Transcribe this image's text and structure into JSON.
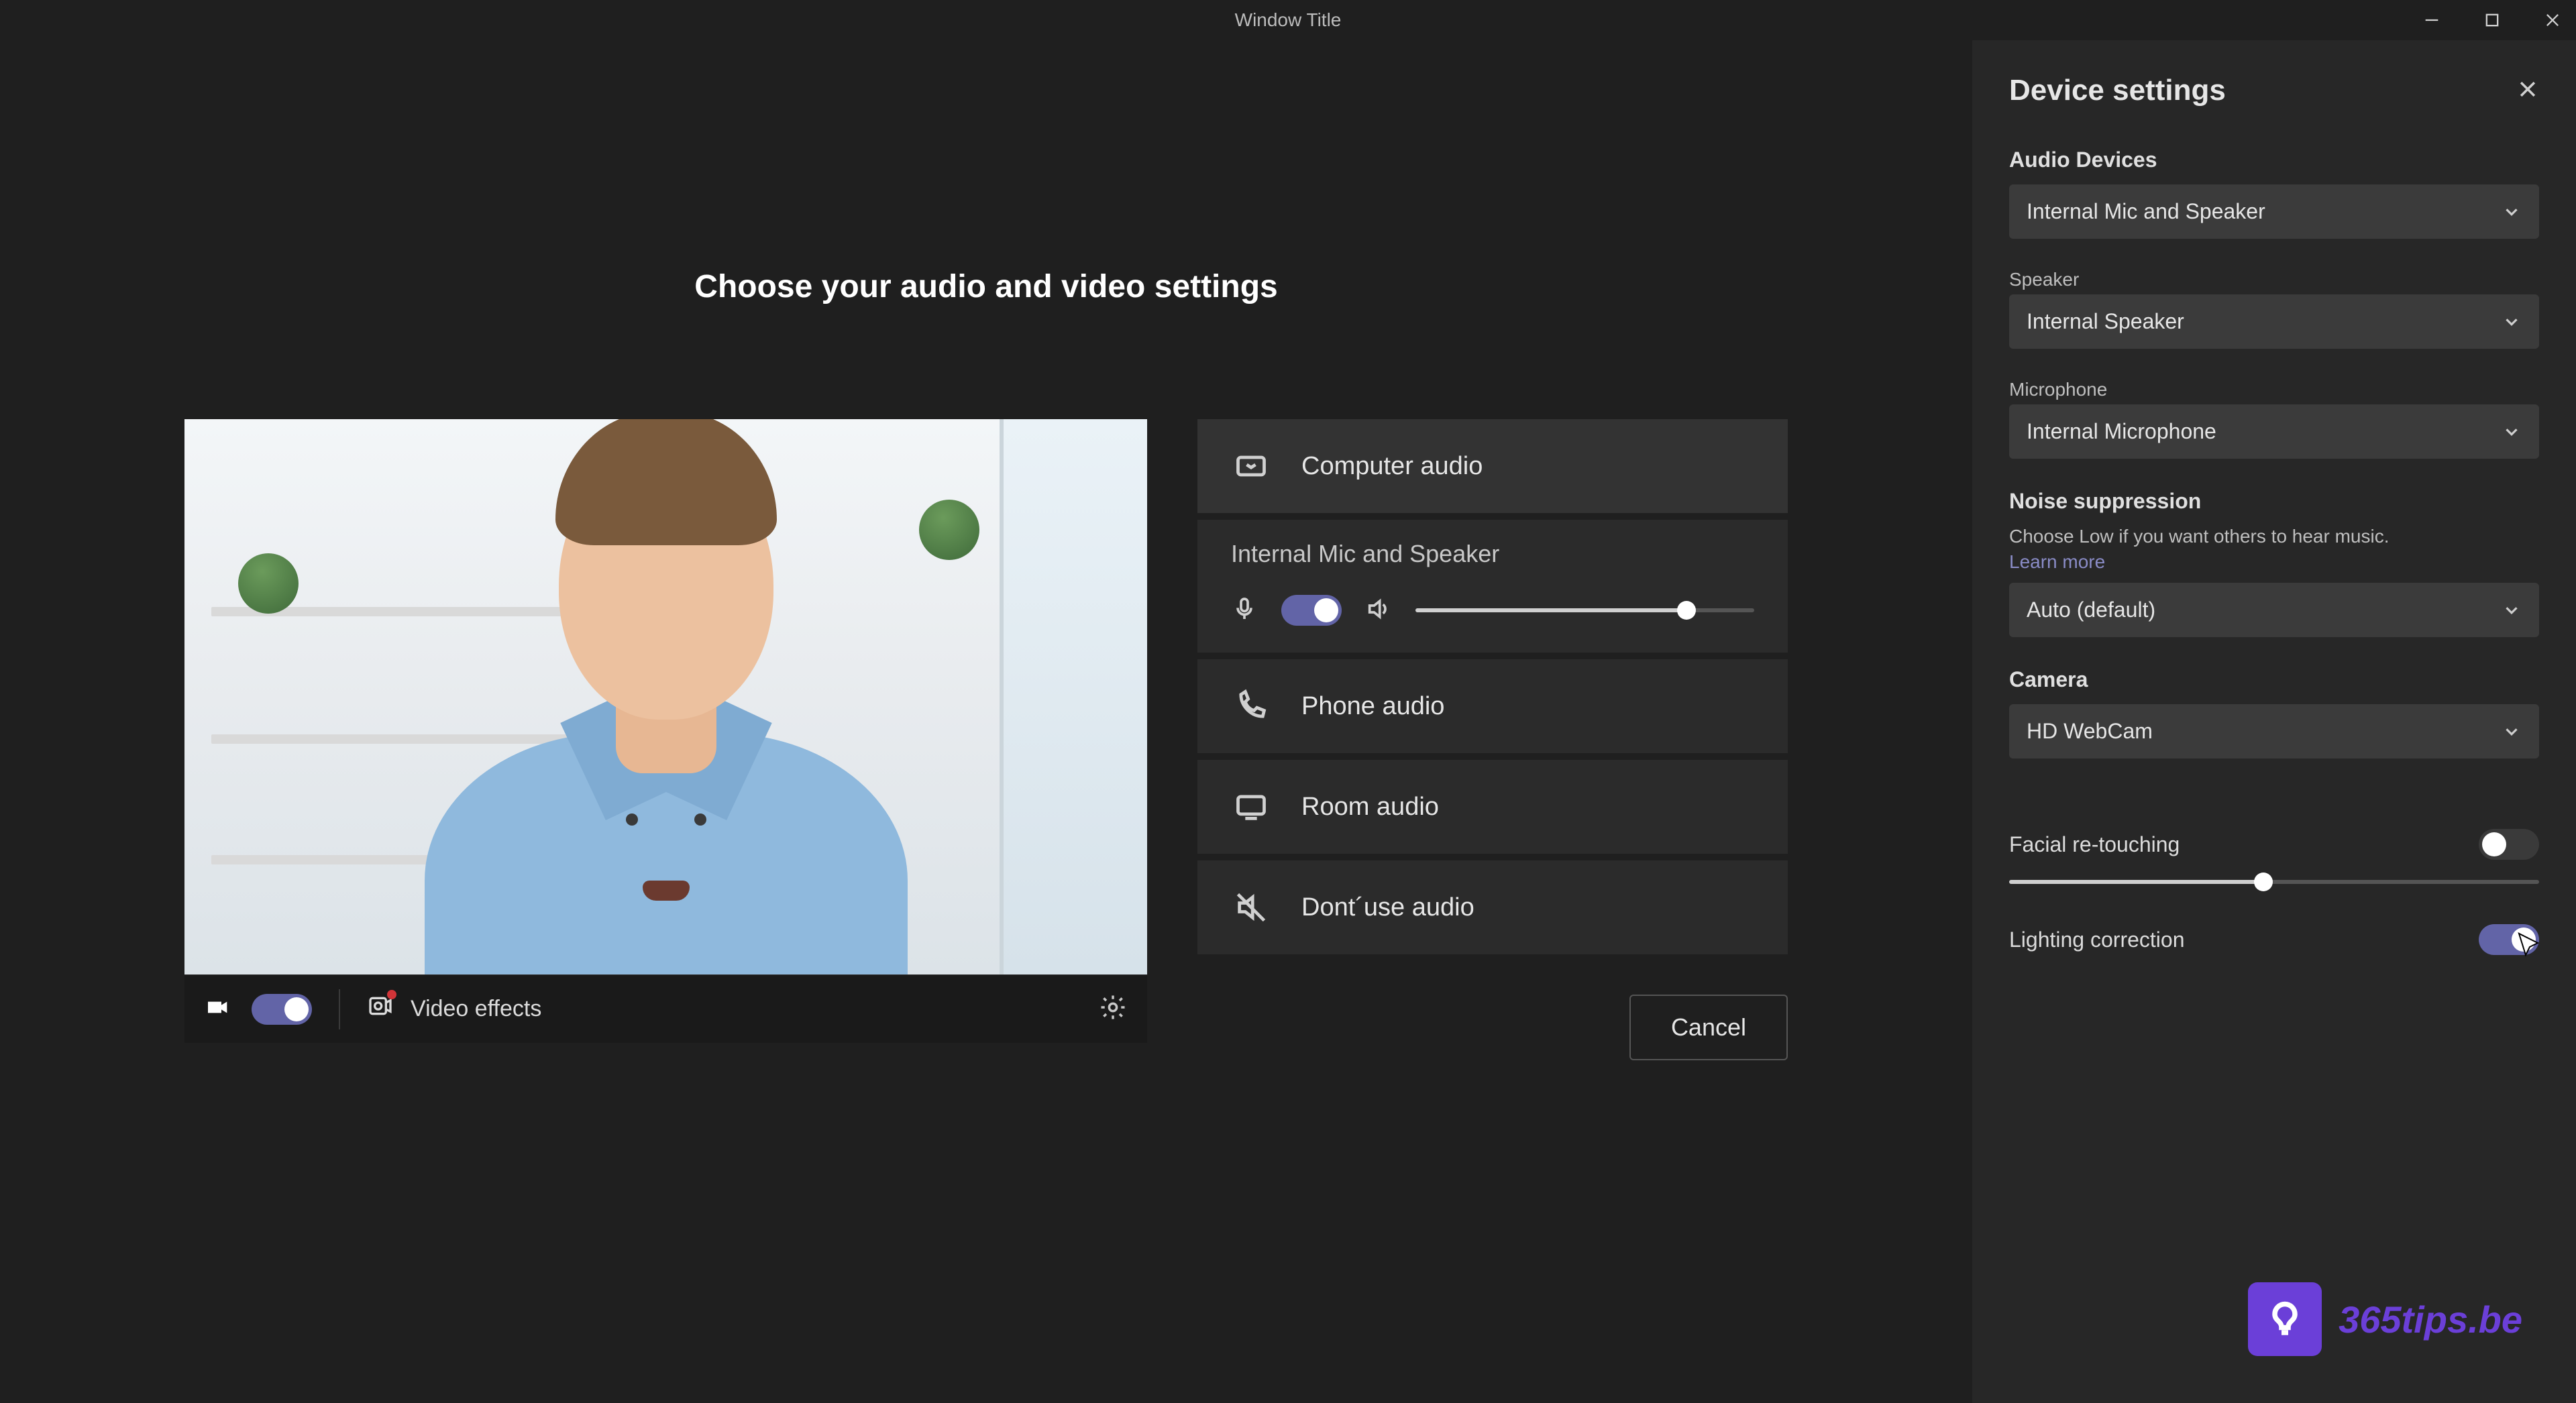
{
  "window": {
    "title": "Window Title"
  },
  "main": {
    "heading": "Choose your audio and video settings",
    "video_effects_label": "Video effects",
    "cancel_label": "Cancel"
  },
  "audio_options": {
    "computer_label": "Computer audio",
    "mic_speaker_label": "Internal Mic and Speaker",
    "phone_label": "Phone audio",
    "room_label": "Room audio",
    "none_label": "Dont´use audio",
    "volume_percent": 80
  },
  "side_panel": {
    "title": "Device settings",
    "audio_devices_label": "Audio Devices",
    "audio_devices_value": "Internal Mic and Speaker",
    "speaker_label": "Speaker",
    "speaker_value": "Internal Speaker",
    "microphone_label": "Microphone",
    "microphone_value": "Internal Microphone",
    "noise_label": "Noise suppression",
    "noise_sub": "Choose Low if you want others to hear music.",
    "learn_more": "Learn more",
    "noise_value": "Auto (default)",
    "camera_label": "Camera",
    "camera_value": "HD WebCam",
    "facial_label": "Facial re-touching",
    "facial_slider_percent": 48,
    "lighting_label": "Lighting correction"
  },
  "watermark": {
    "text": "365tips.be"
  }
}
